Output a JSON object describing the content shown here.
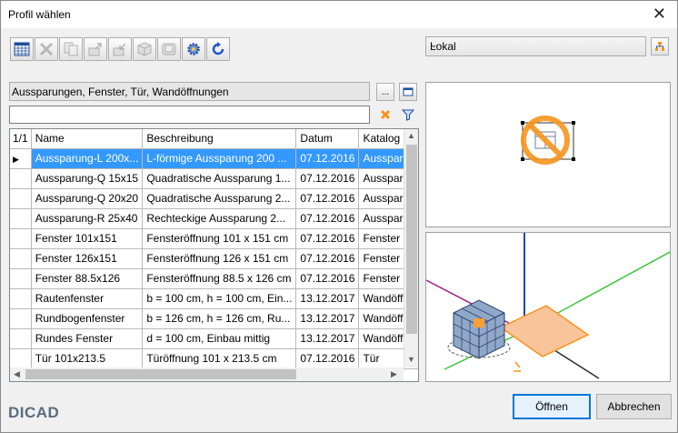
{
  "window": {
    "title": "Profil wählen",
    "close_label": "✕"
  },
  "toolbar": {
    "buttons": [
      {
        "icon": "table-icon",
        "enabled": true
      },
      {
        "icon": "delete-icon",
        "enabled": false
      },
      {
        "icon": "copy-icon",
        "enabled": false
      },
      {
        "icon": "export-icon",
        "enabled": false
      },
      {
        "icon": "import-icon",
        "enabled": false
      },
      {
        "icon": "package-icon",
        "enabled": false
      },
      {
        "icon": "save-icon",
        "enabled": false
      },
      {
        "icon": "settings-gear-icon",
        "enabled": true
      },
      {
        "icon": "refresh-icon",
        "enabled": true
      }
    ]
  },
  "location": {
    "selected": "Lokal"
  },
  "path": {
    "value": "Aussparungen, Fenster, Tür, Wandöffnungen",
    "browse_label": "..."
  },
  "filter": {
    "value": "",
    "placeholder": ""
  },
  "table": {
    "counter": "1/1",
    "headers": {
      "name": "Name",
      "desc": "Beschreibung",
      "date": "Datum",
      "catalog": "Katalog"
    },
    "rows": [
      {
        "name": "Aussparung-L 200x...",
        "desc": "L-förmige Aussparung 200 ...",
        "date": "07.12.2016",
        "catalog": "Aussparungen"
      },
      {
        "name": "Aussparung-Q 15x15",
        "desc": "Quadratische Aussparung 1...",
        "date": "07.12.2016",
        "catalog": "Aussparungen"
      },
      {
        "name": "Aussparung-Q 20x20",
        "desc": "Quadratische Aussparung 2...",
        "date": "07.12.2016",
        "catalog": "Aussparungen"
      },
      {
        "name": "Aussparung-R 25x40",
        "desc": "Rechteckige Aussparung 2...",
        "date": "07.12.2016",
        "catalog": "Aussparungen"
      },
      {
        "name": "Fenster 101x151",
        "desc": "Fensteröffnung 101 x 151 cm",
        "date": "07.12.2016",
        "catalog": "Fenster"
      },
      {
        "name": "Fenster 126x151",
        "desc": "Fensteröffnung 126 x 151 cm",
        "date": "07.12.2016",
        "catalog": "Fenster"
      },
      {
        "name": "Fenster 88.5x126",
        "desc": "Fensteröffnung 88.5 x 126 cm",
        "date": "07.12.2016",
        "catalog": "Fenster"
      },
      {
        "name": "Rautenfenster",
        "desc": "b = 100 cm, h = 100 cm, Ein...",
        "date": "13.12.2017",
        "catalog": "Wandöffnungen"
      },
      {
        "name": "Rundbogenfenster",
        "desc": "b = 126 cm, h = 126 cm, Ru...",
        "date": "13.12.2017",
        "catalog": "Wandöffnungen"
      },
      {
        "name": "Rundes Fenster",
        "desc": "d = 100 cm, Einbau mittig",
        "date": "13.12.2017",
        "catalog": "Wandöffnungen"
      },
      {
        "name": "Tür 101x213.5",
        "desc": "Türöffnung 101 x 213.5 cm",
        "date": "07.12.2016",
        "catalog": "Tür"
      }
    ],
    "selected_row": 0
  },
  "footer": {
    "brand": "DICAD",
    "open_label": "Öffnen",
    "cancel_label": "Abbrechen"
  },
  "colors": {
    "selection": "#3399ff",
    "primary_border": "#0078d7",
    "accent_orange": "#f7941d"
  }
}
